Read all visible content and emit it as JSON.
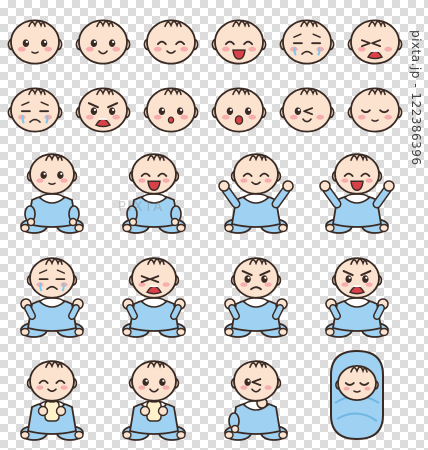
{
  "watermark": {
    "text": "pixta.jp - 122386396"
  },
  "colors": {
    "skin": "#fbe3d0",
    "outline": "#3a2a24",
    "blush": "#f6a6a8",
    "onesie": "#9fd2f2",
    "onesie_dark": "#6fb7e5",
    "bib": "#ffffff",
    "mouth": "#d8414a",
    "tear": "#7ec8ef",
    "bottle": "#fff1c9"
  },
  "stickers": [
    {
      "kind": "head",
      "face": "neutral"
    },
    {
      "kind": "head",
      "face": "smile"
    },
    {
      "kind": "head",
      "face": "happy-closed"
    },
    {
      "kind": "head",
      "face": "laugh"
    },
    {
      "kind": "head",
      "face": "sad-frown"
    },
    {
      "kind": "head",
      "face": "cry-open"
    },
    {
      "kind": "head",
      "face": "cry-lines"
    },
    {
      "kind": "head",
      "face": "angry-shout"
    },
    {
      "kind": "head",
      "face": "surprised"
    },
    {
      "kind": "head",
      "face": "oh"
    },
    {
      "kind": "head",
      "face": "wink"
    },
    {
      "kind": "head",
      "face": "sleep"
    },
    {
      "kind": "body",
      "face": "neutral",
      "pose": "sit"
    },
    {
      "kind": "body",
      "face": "laugh",
      "pose": "sit"
    },
    {
      "kind": "body",
      "face": "happy-closed",
      "pose": "arms-up"
    },
    {
      "kind": "body",
      "face": "laugh",
      "pose": "arms-up"
    },
    {
      "kind": "body",
      "face": "cry-lines",
      "pose": "fists"
    },
    {
      "kind": "body",
      "face": "cry-open",
      "pose": "fists"
    },
    {
      "kind": "body",
      "face": "angry",
      "pose": "fists"
    },
    {
      "kind": "body",
      "face": "angry-shout",
      "pose": "fists"
    },
    {
      "kind": "body",
      "face": "happy-closed",
      "pose": "bottle"
    },
    {
      "kind": "body",
      "face": "smile",
      "pose": "bottle"
    },
    {
      "kind": "body",
      "face": "wink",
      "pose": "thumb"
    },
    {
      "kind": "swaddle",
      "face": "sleep"
    }
  ]
}
